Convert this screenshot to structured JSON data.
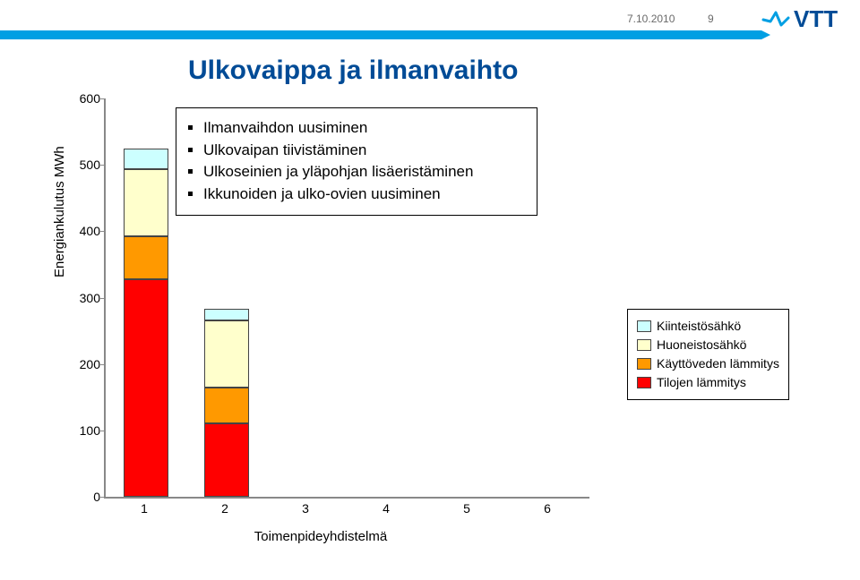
{
  "header": {
    "date": "7.10.2010",
    "page": "9"
  },
  "title": "Ulkovaippa ja ilmanvaihto",
  "bullets": [
    "Ilmanvaihdon uusiminen",
    "Ulkovaipan tiivistäminen",
    "Ulkoseinien ja yläpohjan lisäeristäminen",
    "Ikkunoiden ja ulko-ovien uusiminen"
  ],
  "legend": [
    {
      "key": "kiint",
      "label": "Kiinteistösähkö"
    },
    {
      "key": "huone",
      "label": "Huoneistosähkö"
    },
    {
      "key": "kaytt",
      "label": "Käyttöveden lämmitys"
    },
    {
      "key": "tiloj",
      "label": "Tilojen lämmitys"
    }
  ],
  "chart_data": {
    "type": "bar",
    "title": "Ulkovaippa ja ilmanvaihto",
    "ylabel": "Energiankulutus MWh",
    "xlabel": "Toimenpideyhdistelmä",
    "ylim": [
      0,
      600
    ],
    "yticks": [
      0,
      100,
      200,
      300,
      400,
      500,
      600
    ],
    "categories": [
      "1",
      "2",
      "3",
      "4",
      "5",
      "6"
    ],
    "stack_order": [
      "tiloj",
      "kaytt",
      "huone",
      "kiint"
    ],
    "series": [
      {
        "name": "Tilojen lämmitys",
        "key": "tiloj",
        "values": [
          328,
          110,
          null,
          null,
          null,
          null
        ]
      },
      {
        "name": "Käyttöveden lämmitys",
        "key": "kaytt",
        "values": [
          65,
          55,
          null,
          null,
          null,
          null
        ]
      },
      {
        "name": "Huoneistosähkö",
        "key": "huone",
        "values": [
          100,
          100,
          null,
          null,
          null,
          null
        ]
      },
      {
        "name": "Kiinteistösähkö",
        "key": "kiint",
        "values": [
          32,
          18,
          null,
          null,
          null,
          null
        ]
      }
    ]
  }
}
